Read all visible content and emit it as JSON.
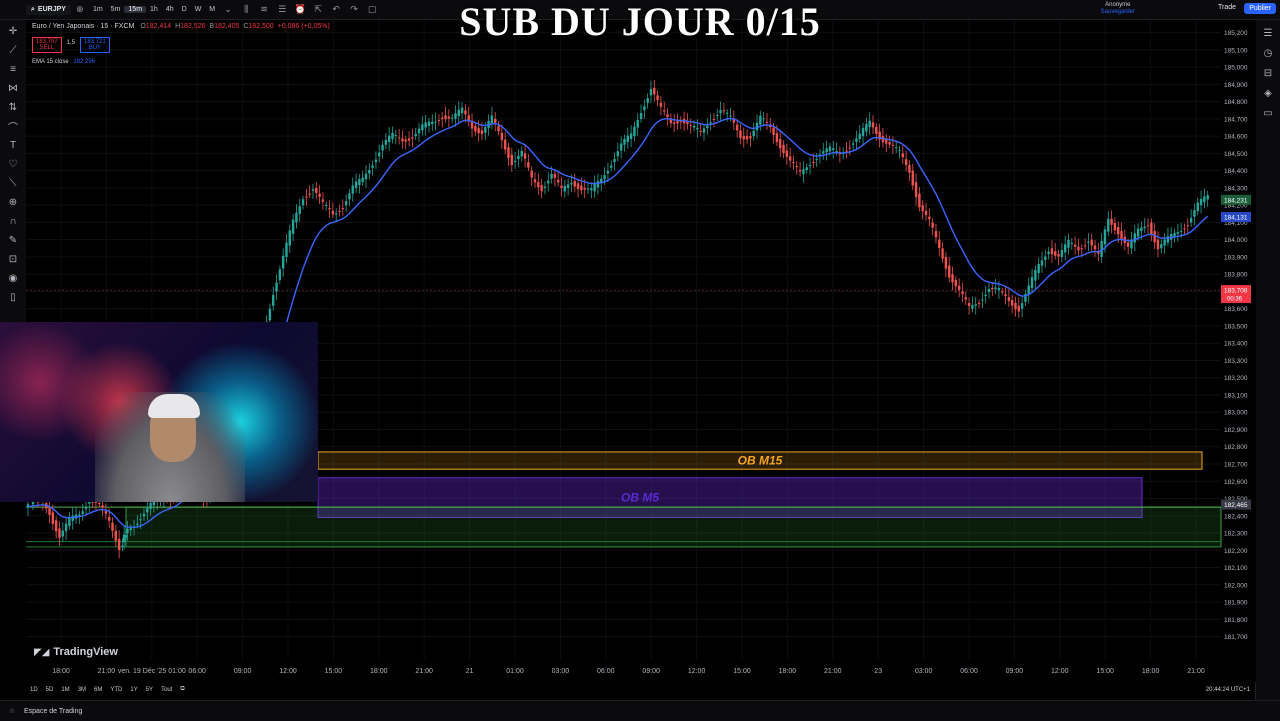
{
  "overlay_title": "SUB DU JOUR 0/15",
  "toolbar": {
    "symbol": "EURJPY",
    "intervals": [
      "1m",
      "5m",
      "15m",
      "1h",
      "4h",
      "D",
      "W",
      "M"
    ],
    "active_interval": "15m",
    "account_name": "Anonyme",
    "account_save": "Sauvegarder",
    "trade_label": "Trade",
    "publish_label": "Publier"
  },
  "legend": {
    "name": "Euro / Yen Japonais · 15 · FXCM",
    "o_label": "O",
    "o_value": "182,414",
    "h_label": "H",
    "h_value": "182,526",
    "l_label": "B",
    "l_value": "182,405",
    "c_label": "C",
    "c_value": "182,500",
    "change": "+0,086 (+0,05%)",
    "sell_price": "183,707",
    "sell_label": "SELL",
    "spread": "1,5",
    "buy_price": "183,721",
    "buy_label": "BUY",
    "ema_label": "EMA 15 close",
    "ema_value": "182,296"
  },
  "chart_data": {
    "type": "candlestick",
    "price_axis": [
      "185,200",
      "185,100",
      "185,000",
      "184,900",
      "184,800",
      "184,700",
      "184,600",
      "184,500",
      "184,400",
      "184,300",
      "184,200",
      "184,100",
      "184,000",
      "183,900",
      "183,800",
      "183,700",
      "183,600",
      "183,500",
      "183,400",
      "183,300",
      "183,200",
      "183,100",
      "183,000",
      "182,900",
      "182,800",
      "182,700",
      "182,600",
      "182,500",
      "182,400",
      "182,300",
      "182,200",
      "182,100",
      "182,000",
      "181,900",
      "181,800",
      "181,700"
    ],
    "ylim": [
      181.68,
      185.25
    ],
    "time_axis": [
      "18:00",
      "21:00",
      "ven. 19 Déc '25  01:00",
      "06:00",
      "09:00",
      "12:00",
      "15:00",
      "18:00",
      "21:00",
      "21",
      "01:00",
      "03:00",
      "06:00",
      "09:00",
      "12:00",
      "15:00",
      "18:00",
      "21:00",
      "23",
      "03:00",
      "06:00",
      "09:00",
      "12:00",
      "15:00",
      "18:00",
      "21:00"
    ],
    "price_labels": {
      "ema": "184,131",
      "top": "184,231",
      "current": "183,708",
      "countdown": "00:36",
      "crosshair": "182,465"
    },
    "price_path": [
      [
        0,
        182.45
      ],
      [
        15,
        182.5
      ],
      [
        25,
        182.42
      ],
      [
        35,
        182.28
      ],
      [
        45,
        182.37
      ],
      [
        55,
        182.41
      ],
      [
        65,
        182.5
      ],
      [
        75,
        182.46
      ],
      [
        85,
        182.36
      ],
      [
        95,
        182.22
      ],
      [
        100,
        182.3
      ],
      [
        110,
        182.35
      ],
      [
        120,
        182.42
      ],
      [
        130,
        182.48
      ],
      [
        140,
        182.5
      ],
      [
        150,
        182.52
      ],
      [
        160,
        182.6
      ],
      [
        170,
        182.7
      ],
      [
        180,
        182.5
      ],
      [
        190,
        182.55
      ],
      [
        200,
        182.65
      ],
      [
        210,
        182.9
      ],
      [
        220,
        183.1
      ],
      [
        230,
        183.3
      ],
      [
        240,
        183.45
      ],
      [
        250,
        183.7
      ],
      [
        260,
        183.9
      ],
      [
        270,
        184.1
      ],
      [
        280,
        184.25
      ],
      [
        290,
        184.3
      ],
      [
        300,
        184.2
      ],
      [
        310,
        184.15
      ],
      [
        320,
        184.2
      ],
      [
        330,
        184.3
      ],
      [
        340,
        184.35
      ],
      [
        350,
        184.45
      ],
      [
        360,
        184.55
      ],
      [
        370,
        184.6
      ],
      [
        380,
        184.58
      ],
      [
        390,
        184.6
      ],
      [
        400,
        184.65
      ],
      [
        410,
        184.68
      ],
      [
        420,
        184.72
      ],
      [
        430,
        184.7
      ],
      [
        440,
        184.75
      ],
      [
        450,
        184.66
      ],
      [
        460,
        184.62
      ],
      [
        470,
        184.7
      ],
      [
        480,
        184.58
      ],
      [
        490,
        184.45
      ],
      [
        500,
        184.5
      ],
      [
        510,
        184.35
      ],
      [
        520,
        184.3
      ],
      [
        530,
        184.38
      ],
      [
        540,
        184.28
      ],
      [
        550,
        184.34
      ],
      [
        560,
        184.3
      ],
      [
        570,
        184.28
      ],
      [
        580,
        184.35
      ],
      [
        590,
        184.45
      ],
      [
        600,
        184.55
      ],
      [
        610,
        184.6
      ],
      [
        620,
        184.75
      ],
      [
        630,
        184.88
      ],
      [
        640,
        184.75
      ],
      [
        650,
        184.68
      ],
      [
        660,
        184.7
      ],
      [
        670,
        184.65
      ],
      [
        680,
        184.62
      ],
      [
        690,
        184.7
      ],
      [
        700,
        184.75
      ],
      [
        710,
        184.7
      ],
      [
        720,
        184.6
      ],
      [
        730,
        184.6
      ],
      [
        740,
        184.7
      ],
      [
        750,
        184.65
      ],
      [
        760,
        184.55
      ],
      [
        770,
        184.45
      ],
      [
        780,
        184.38
      ],
      [
        790,
        184.45
      ],
      [
        800,
        184.5
      ],
      [
        810,
        184.52
      ],
      [
        820,
        184.5
      ],
      [
        830,
        184.55
      ],
      [
        840,
        184.6
      ],
      [
        850,
        184.68
      ],
      [
        860,
        184.6
      ],
      [
        870,
        184.55
      ],
      [
        880,
        184.5
      ],
      [
        890,
        184.4
      ],
      [
        900,
        184.2
      ],
      [
        910,
        184.1
      ],
      [
        920,
        183.95
      ],
      [
        930,
        183.8
      ],
      [
        940,
        183.7
      ],
      [
        950,
        183.6
      ],
      [
        960,
        183.65
      ],
      [
        970,
        183.72
      ],
      [
        980,
        183.7
      ],
      [
        990,
        183.65
      ],
      [
        1000,
        183.6
      ],
      [
        1010,
        183.72
      ],
      [
        1020,
        183.85
      ],
      [
        1030,
        183.95
      ],
      [
        1040,
        183.9
      ],
      [
        1050,
        183.98
      ],
      [
        1060,
        183.95
      ],
      [
        1070,
        184.0
      ],
      [
        1080,
        183.9
      ],
      [
        1090,
        184.12
      ],
      [
        1100,
        184.05
      ],
      [
        1110,
        183.95
      ],
      [
        1120,
        184.05
      ],
      [
        1130,
        184.1
      ],
      [
        1140,
        183.95
      ],
      [
        1150,
        184.0
      ],
      [
        1160,
        184.05
      ],
      [
        1170,
        184.1
      ],
      [
        1180,
        184.2
      ],
      [
        1190,
        184.25
      ]
    ],
    "zones": [
      {
        "name": "OB M15",
        "low": 182.67,
        "high": 182.77,
        "color": "#f5a623"
      },
      {
        "name": "OB M5",
        "low": 182.39,
        "high": 182.62,
        "color": "#6b2bd9"
      },
      {
        "name": "",
        "low": 182.22,
        "high": 182.45,
        "color": "#3aa33a"
      }
    ]
  },
  "bottom": {
    "ranges": [
      "1D",
      "5D",
      "1M",
      "3M",
      "6M",
      "YTD",
      "1Y",
      "5Y",
      "Tout"
    ],
    "clock": "20:44:24 UTC+1",
    "brand": "TradingView",
    "workspace": "Espace de Trading"
  }
}
